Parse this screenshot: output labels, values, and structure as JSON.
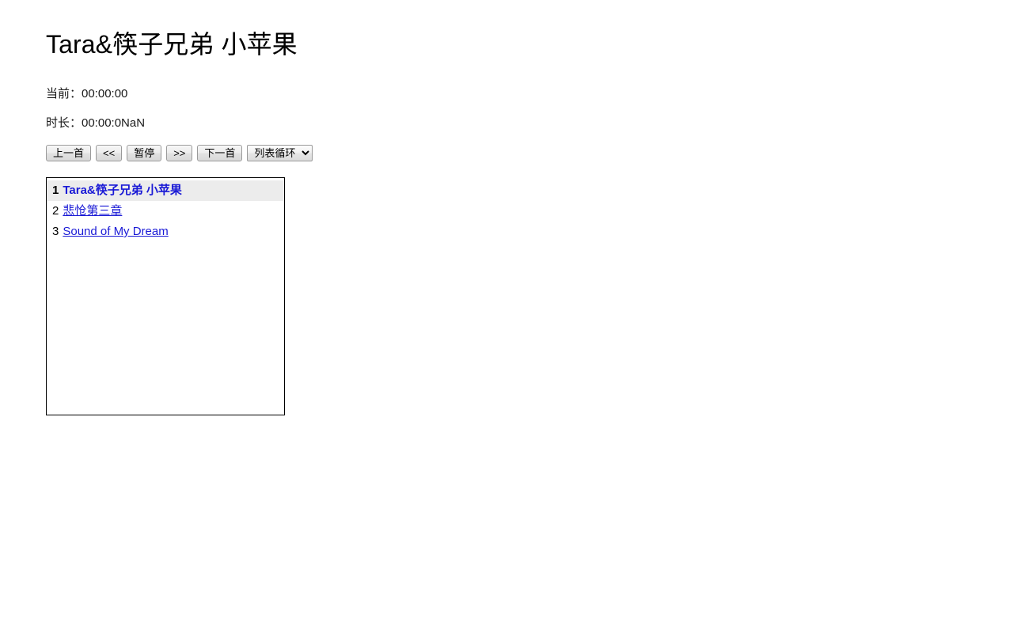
{
  "page": {
    "title": "Tara&筷子兄弟 小苹果"
  },
  "status": {
    "current_label": "当前：",
    "current_time": "00:00:00",
    "current_line": "当前：00:00:00",
    "duration_label": "时长：",
    "duration_time": "00:00:0NaN",
    "duration_line": "时长：00:00:0NaN"
  },
  "controls": {
    "prev": "上一首",
    "rewind": "<<",
    "pause": "暂停",
    "forward": ">>",
    "next": "下一首",
    "mode_selected": "列表循环",
    "mode_options": [
      "列表循环"
    ],
    "dropdown_arrow": "▼"
  },
  "playlist": {
    "items": [
      {
        "index": "1",
        "name": "Tara&筷子兄弟 小苹果",
        "active": true
      },
      {
        "index": "2",
        "name": "悲怆第三章",
        "active": false
      },
      {
        "index": "3",
        "name": "Sound of My Dream",
        "active": false
      }
    ]
  },
  "colors": {
    "link": "#1a1ad6",
    "active_row_bg": "#ececec",
    "border": "#000000",
    "page_bg": "#ffffff",
    "text": "#000000"
  }
}
